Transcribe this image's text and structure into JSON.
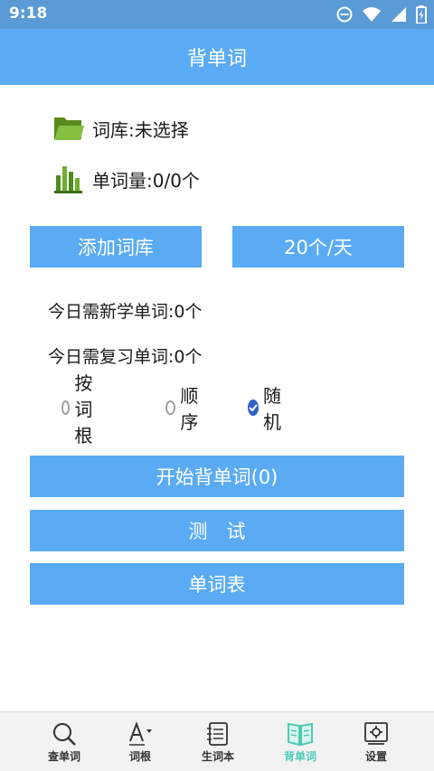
{
  "status_bar": {
    "time": "9:18"
  },
  "app_bar": {
    "title": "背单词"
  },
  "wordbank": {
    "label": "词库:未选择",
    "icon": "folder-icon"
  },
  "word_count": {
    "label": "单词量:0/0个",
    "icon": "bar-chart-icon"
  },
  "buttons": {
    "add_wordbank": "添加词库",
    "daily_amount": "20个/天",
    "start": "开始背单词(0)",
    "test": "测　试",
    "word_list": "单词表"
  },
  "today": {
    "new_words": "今日需新学单词:0个",
    "review_words": "今日需复习单词:0个"
  },
  "order_options": [
    {
      "label": "按词根",
      "checked": false
    },
    {
      "label": "顺序",
      "checked": false
    },
    {
      "label": "随机",
      "checked": true
    }
  ],
  "bottom_nav": [
    {
      "label": "查单词",
      "icon": "search-icon",
      "active": false
    },
    {
      "label": "词根",
      "icon": "font-letter-icon",
      "active": false
    },
    {
      "label": "生词本",
      "icon": "notebook-icon",
      "active": false
    },
    {
      "label": "背单词",
      "icon": "open-book-icon",
      "active": true
    },
    {
      "label": "设置",
      "icon": "settings-icon",
      "active": false
    }
  ],
  "colors": {
    "status_bar": "#5a9bd6",
    "primary": "#5aabf3",
    "nav_active": "#4cc9b4",
    "radio_checked": "#2d5fc4"
  }
}
